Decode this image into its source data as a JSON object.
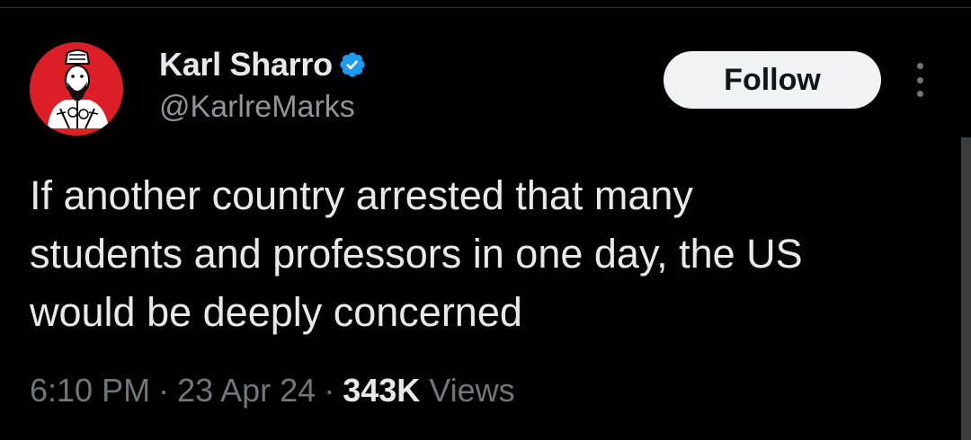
{
  "tweet": {
    "author": {
      "display_name": "Karl Sharro",
      "handle": "@KarlreMarks",
      "verified": true,
      "avatar_icon": "illustrated-man-portrait-avatar",
      "avatar_bg": "#dc1f26",
      "badge_color": "#1d9bf0"
    },
    "follow_label": "Follow",
    "more_icon": "more-vertical-icon",
    "text_lines": [
      "If another country arrested that many",
      "students and professors in one day, the US",
      "would be deeply concerned"
    ],
    "time": "6:10 PM",
    "separator": "·",
    "date": "23 Apr 24",
    "views_count": "343K",
    "views_label": "Views"
  }
}
